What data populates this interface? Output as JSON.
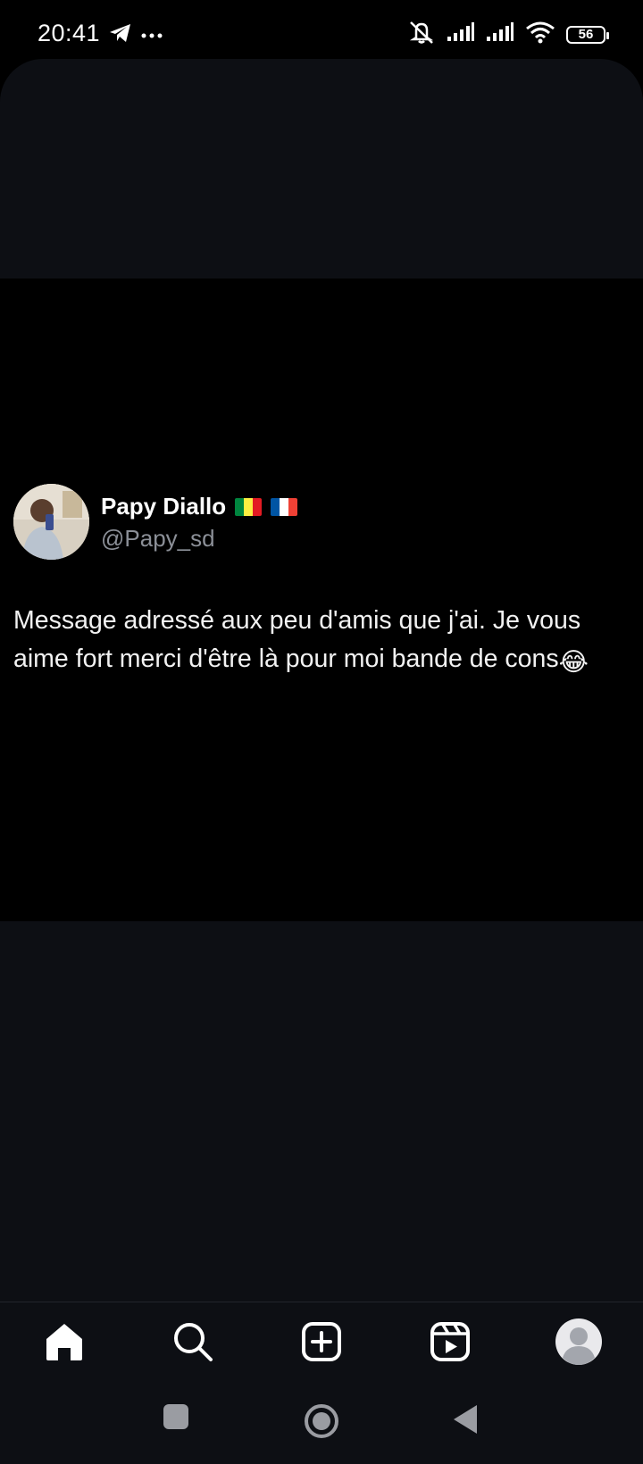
{
  "status_bar": {
    "time": "20:41",
    "battery": "56",
    "icons": [
      "telegram-icon",
      "more-icon",
      "mute-icon",
      "signal-icon",
      "signal-icon",
      "wifi-icon",
      "battery-icon"
    ]
  },
  "post": {
    "author_name": "Papy Diallo",
    "author_handle": "@Papy_sd",
    "flags": [
      "senegal-flag",
      "france-flag"
    ],
    "text": "Message adressé aux peu d'amis que j'ai. Je vous aime fort merci d'être là pour moi bande de cons",
    "emoji": "😂"
  },
  "bottom_nav": {
    "items": [
      "home-icon",
      "search-icon",
      "create-icon",
      "reels-icon",
      "profile-icon"
    ]
  },
  "system_nav": {
    "items": [
      "recents-button",
      "home-button",
      "back-button"
    ]
  },
  "colors": {
    "background": "#000000",
    "sheet": "#0d0f14",
    "handle_gray": "#8b8f97"
  }
}
